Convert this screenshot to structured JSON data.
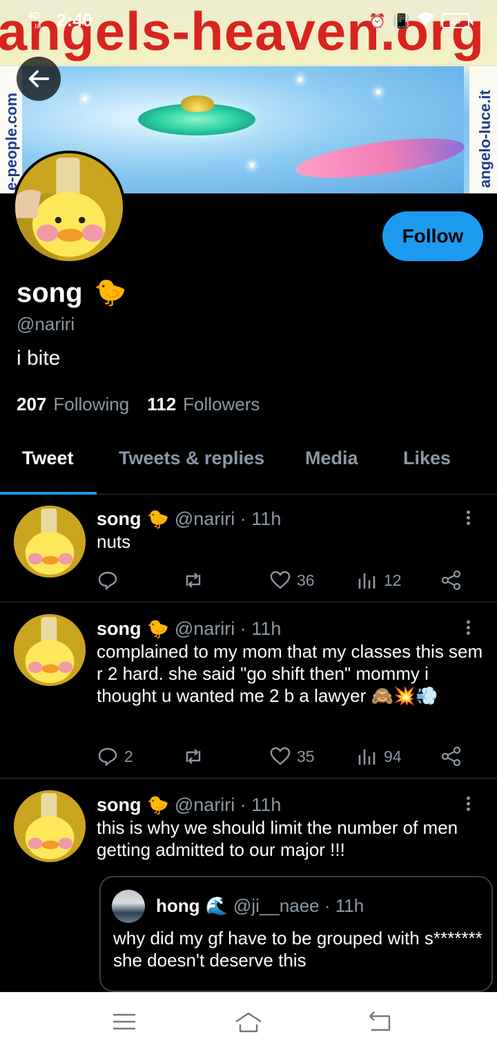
{
  "status_bar": {
    "network": "4G",
    "signal": "ııl",
    "time": "2:40",
    "alarm_icon": "alarm-icon",
    "vibrate_icon": "vibrate-icon",
    "wifi_icon": "wifi-icon",
    "battery": "20"
  },
  "banner": {
    "site_text": "angels-heaven.org",
    "left_text": "e-people.com",
    "right_text": "angelo-luce.it"
  },
  "profile": {
    "display_name": "song",
    "name_emoji": "🐤",
    "handle": "@nariri",
    "bio": "i bite",
    "following_count": "207",
    "following_label": "Following",
    "followers_count": "112",
    "followers_label": "Followers",
    "follow_label": "Follow"
  },
  "tabs": [
    {
      "label": "Tweet",
      "active": true
    },
    {
      "label": "Tweets & replies",
      "active": false
    },
    {
      "label": "Media",
      "active": false
    },
    {
      "label": "Likes",
      "active": false
    }
  ],
  "tweets": [
    {
      "name": "song",
      "emoji": "🐤",
      "meta": "@nariri · 11h",
      "text": "nuts",
      "replies": "",
      "likes": "36",
      "views": "12"
    },
    {
      "name": "song",
      "emoji": "🐤",
      "meta": "@nariri · 11h",
      "text": "complained to my mom that my classes this sem r 2 hard. she said \"go shift then\" mommy i thought u wanted me 2 b a lawyer 🙈💥💨",
      "replies": "2",
      "likes": "35",
      "views": "94"
    },
    {
      "name": "song",
      "emoji": "🐤",
      "meta": "@nariri · 11h",
      "text": "this is why we should limit the number of men getting admitted to our major !!!",
      "quote": {
        "name": "hong",
        "emoji": "🌊",
        "meta": "@ji__naee · 11h",
        "text": "why did my gf have to be grouped with s******* she doesn't deserve this"
      }
    }
  ],
  "colors": {
    "accent": "#1d9bf0",
    "muted": "#8b98a5",
    "background": "#000000",
    "divider": "#2f3336"
  }
}
